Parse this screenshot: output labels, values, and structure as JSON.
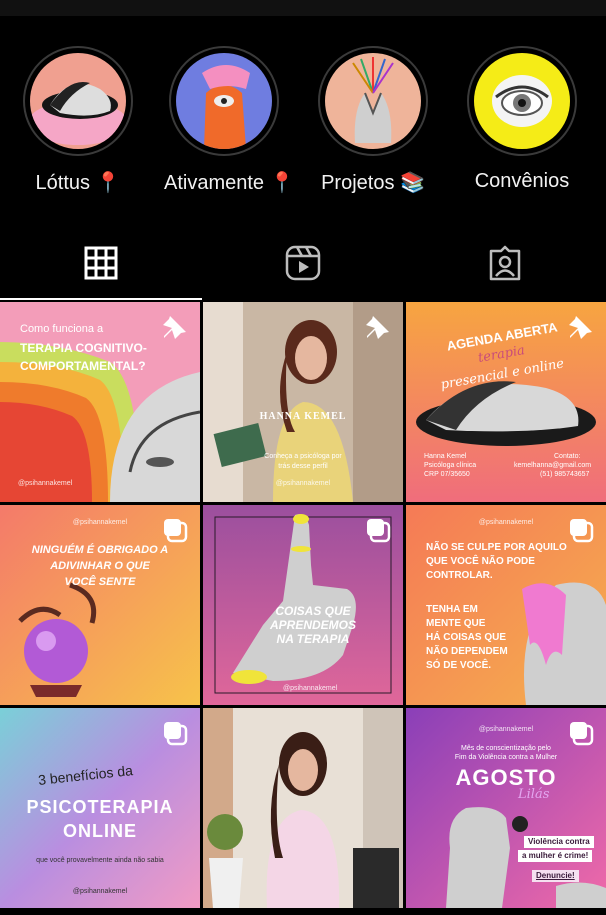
{
  "highlights": [
    {
      "label": "Lóttus 📍"
    },
    {
      "label": "Ativamente 📍"
    },
    {
      "label": "Projetos 📚"
    },
    {
      "label": "Convênios"
    }
  ],
  "tabs": [
    {
      "icon": "grid-icon",
      "active": true
    },
    {
      "icon": "reels-icon",
      "active": false
    },
    {
      "icon": "tagged-icon",
      "active": false
    }
  ],
  "posts": [
    {
      "line1": "Como funciona a",
      "line2": "TERAPIA COGNITIVO-",
      "line3": "COMPORTAMENTAL?",
      "handle": "@psihannakemel",
      "badge": "pin-icon"
    },
    {
      "name": "HANNA KEMEL",
      "line1": "Conheça a psicóloga por",
      "line2": "trás desse perfil",
      "handle": "@psihannakemel",
      "badge": "pin-icon"
    },
    {
      "line1": "AGENDA ABERTA",
      "line2": "terapia",
      "line3": "presencial e online",
      "info_name": "Hanna Kemel",
      "info_role": "Psicóloga clínica",
      "info_crp": "CRP 07/35650",
      "contact_label": "Contato:",
      "contact_email": "kemelhanna@gmail.com",
      "contact_phone": "(51) 985743657",
      "badge": "pin-icon"
    },
    {
      "handle": "@psihannakemel",
      "line1": "NINGUÉM É OBRIGADO A",
      "line2": "ADIVINHAR O QUE",
      "line3": "VOCÊ SENTE",
      "badge": "multi-icon"
    },
    {
      "line1": "COISAS QUE",
      "line2": "APRENDEMOS",
      "line3": "NA TERAPIA",
      "handle": "@psihannakemel",
      "badge": "multi-icon"
    },
    {
      "handle": "@psihannakemel",
      "line1": "NÃO SE CULPE POR AQUILO",
      "line2": "QUE VOCÊ NÃO PODE",
      "line3": "CONTROLAR.",
      "line4": "TENHA EM",
      "line5": "MENTE QUE",
      "line6": "HÁ COISAS QUE",
      "line7": "NÃO DEPENDEM",
      "line8": "SÓ DE VOCÊ.",
      "badge": "multi-icon"
    },
    {
      "line1": "3 benefícios da",
      "line2": "PSICOTERAPIA",
      "line3": "ONLINE",
      "line4": "que você provavelmente ainda não sabia",
      "handle": "@psihannakemel",
      "badge": "multi-icon"
    },
    {
      "badge": "none"
    },
    {
      "handle": "@psihannakemel",
      "line1": "Mês de conscientização pelo",
      "line2": "Fim da Violência contra a Mulher",
      "line3": "AGOSTO",
      "line4": "Lilás",
      "line5": "Violência contra",
      "line6": "a mulher é crime!",
      "line7": "Denuncie!",
      "badge": "multi-icon"
    }
  ]
}
